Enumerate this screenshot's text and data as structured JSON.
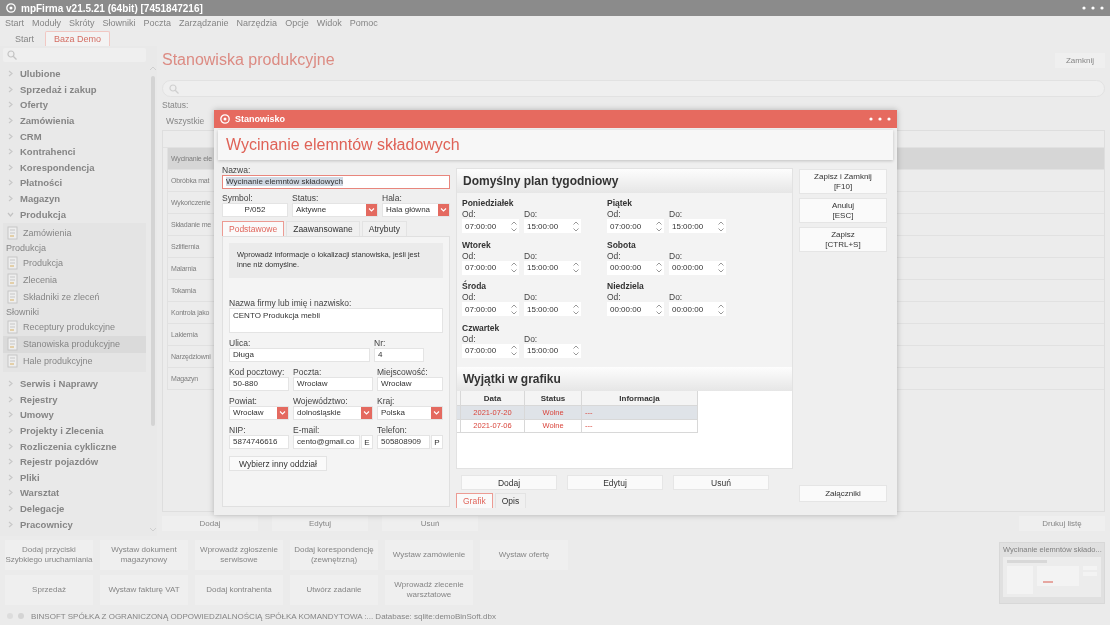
{
  "window": {
    "title": "mpFirma v21.5.21 (64bit) [7451847216]"
  },
  "menu": [
    "Start",
    "Moduły",
    "Skróty",
    "Słowniki",
    "Poczta",
    "Zarządzanie",
    "Narzędzia",
    "Opcje",
    "Widok",
    "Pomoc"
  ],
  "tabs": [
    {
      "label": "Start",
      "selected": false
    },
    {
      "label": "Baza Demo",
      "selected": true
    }
  ],
  "sidebar": {
    "items": [
      {
        "label": "Ulubione",
        "expanded": false
      },
      {
        "label": "Sprzedaż i zakup",
        "expanded": false
      },
      {
        "label": "Oferty",
        "expanded": false
      },
      {
        "label": "Zamówienia",
        "expanded": false
      },
      {
        "label": "CRM",
        "expanded": false
      },
      {
        "label": "Kontrahenci",
        "expanded": false
      },
      {
        "label": "Korespondencja",
        "expanded": false
      },
      {
        "label": "Płatności",
        "expanded": false
      },
      {
        "label": "Magazyn",
        "expanded": false
      },
      {
        "label": "Produkcja",
        "expanded": true,
        "children": [
          {
            "kind": "link",
            "label": "Zamówienia",
            "selected": false
          },
          {
            "kind": "section",
            "label": "Produkcja"
          },
          {
            "kind": "link",
            "label": "Produkcja",
            "selected": false
          },
          {
            "kind": "link",
            "label": "Zlecenia",
            "selected": false
          },
          {
            "kind": "link",
            "label": "Składniki ze zleceń",
            "selected": false
          },
          {
            "kind": "section",
            "label": "Słowniki"
          },
          {
            "kind": "link",
            "label": "Receptury produkcyjne",
            "selected": false
          },
          {
            "kind": "link",
            "label": "Stanowiska produkcyjne",
            "selected": true
          },
          {
            "kind": "link",
            "label": "Hale produkcyjne",
            "selected": false
          }
        ]
      },
      {
        "label": "Serwis i Naprawy",
        "expanded": false
      },
      {
        "label": "Rejestry",
        "expanded": false
      },
      {
        "label": "Umowy",
        "expanded": false
      },
      {
        "label": "Projekty i Zlecenia",
        "expanded": false
      },
      {
        "label": "Rozliczenia cykliczne",
        "expanded": false
      },
      {
        "label": "Rejestr pojazdów",
        "expanded": false
      },
      {
        "label": "Pliki",
        "expanded": false
      },
      {
        "label": "Warsztat",
        "expanded": false
      },
      {
        "label": "Delegacje",
        "expanded": false
      },
      {
        "label": "Pracownicy",
        "expanded": false
      }
    ]
  },
  "list_view": {
    "title": "Stanowiska produkcyjne",
    "close_button": "Zamknij",
    "status_label": "Status:",
    "status_value": "Wszystkie",
    "rows": [
      {
        "name": "Wycinanie ele",
        "selected": true
      },
      {
        "name": "Obróbka mat",
        "selected": false
      },
      {
        "name": "Wykończenie",
        "selected": false
      },
      {
        "name": "Składanie me",
        "selected": false
      },
      {
        "name": "Szlifiernia",
        "selected": false
      },
      {
        "name": "Malarnia",
        "selected": false
      },
      {
        "name": "Tokarnia",
        "selected": false
      },
      {
        "name": "Kontrola jako",
        "selected": false
      },
      {
        "name": "Lakiernia",
        "selected": false
      },
      {
        "name": "Narzędziowni",
        "selected": false
      },
      {
        "name": "Magazyn",
        "selected": false
      }
    ],
    "buttons": [
      "Dodaj",
      "Edytuj",
      "Usuń"
    ],
    "print_button": "Drukuj listę"
  },
  "quick_actions": [
    {
      "lines": [
        "Dodaj przyciski",
        "Szybkiego uruchamiania"
      ]
    },
    {
      "lines": [
        "Wystaw dokument",
        "magazynowy"
      ]
    },
    {
      "lines": [
        "Wprowadź zgłoszenie",
        "serwisowe"
      ]
    },
    {
      "lines": [
        "Dodaj korespondencję",
        "(zewnętrzną)"
      ]
    },
    {
      "lines": [
        "Wystaw zamówienie"
      ]
    },
    {
      "lines": [
        "Wystaw ofertę"
      ]
    },
    {
      "lines": [
        "Sprzedaż"
      ]
    },
    {
      "lines": [
        "Wystaw fakturę VAT"
      ]
    },
    {
      "lines": [
        "Dodaj kontrahenta"
      ]
    },
    {
      "lines": [
        "Utwórz zadanie"
      ]
    },
    {
      "lines": [
        "Wprowadź zlecenie",
        "warsztatowe"
      ]
    }
  ],
  "preview": {
    "title": "Wycinanie elemntów składo..."
  },
  "status_bar": {
    "text": "BINSOFT SPÓŁKA Z OGRANICZONĄ ODPOWIEDZIALNOŚCIĄ SPÓŁKA KOMANDYTOWA :... Database: sqlite:demoBinSoft.dbx"
  },
  "dialog": {
    "title": "Stanowisko",
    "heading": "Wycinanie elemntów składowych",
    "name": {
      "label": "Nazwa:",
      "value": "Wycinanie elemntów składowych"
    },
    "top_fields": [
      {
        "kind": "text",
        "label": "Symbol:",
        "value": "P/052"
      },
      {
        "kind": "dropdown",
        "label": "Status:",
        "value": "Aktywne"
      },
      {
        "kind": "dropdown",
        "label": "Hala:",
        "value": "Hala główna"
      }
    ],
    "tabs": [
      {
        "label": "Podstawowe",
        "selected": true
      },
      {
        "label": "Zaawansowane",
        "selected": false
      },
      {
        "label": "Atrybuty",
        "selected": false
      }
    ],
    "info": "Wprowadź informacje o lokalizacji stanowiska, jeśli jest inne niż domyślne.",
    "address_rows": [
      [
        {
          "kind": "textarea",
          "label": "Nazwa firmy lub imię i nazwisko:",
          "value": "CENTO Produkcja mebli"
        }
      ],
      [
        {
          "kind": "text",
          "label": "Ulica:",
          "value": "Długa"
        },
        {
          "kind": "text",
          "label": "Nr:",
          "value": "4"
        }
      ],
      [
        {
          "kind": "text",
          "label": "Kod pocztowy:",
          "value": "50-880"
        },
        {
          "kind": "text",
          "label": "Poczta:",
          "value": "Wrocław"
        },
        {
          "kind": "text",
          "label": "Miejscowość:",
          "value": "Wrocław"
        }
      ],
      [
        {
          "kind": "dropdown",
          "label": "Powiat:",
          "value": "Wrocław"
        },
        {
          "kind": "dropdown",
          "label": "Województwo:",
          "value": "dolnośląskie"
        },
        {
          "kind": "dropdown",
          "label": "Kraj:",
          "value": "Polska"
        }
      ],
      [
        {
          "kind": "text",
          "label": "NIP:",
          "value": "5874746616"
        },
        {
          "kind": "action",
          "label": "E-mail:",
          "value": "cento@gmail.co",
          "button": "E"
        },
        {
          "kind": "action",
          "label": "Telefon:",
          "value": "505808909",
          "button": "P"
        }
      ]
    ],
    "branch_button": "Wybierz inny oddział",
    "schedule": {
      "title": "Domyślny plan tygodniowy",
      "columns": [
        [
          {
            "day": "Poniedziałek",
            "from_label": "Od:",
            "from": "07:00:00",
            "to_label": "Do:",
            "to": "15:00:00"
          },
          {
            "day": "Wtorek",
            "from_label": "Od:",
            "from": "07:00:00",
            "to_label": "Do:",
            "to": "15:00:00"
          },
          {
            "day": "Środa",
            "from_label": "Od:",
            "from": "07:00:00",
            "to_label": "Do:",
            "to": "15:00:00"
          },
          {
            "day": "Czwartek",
            "from_label": "Od:",
            "from": "07:00:00",
            "to_label": "Do:",
            "to": "15:00:00"
          }
        ],
        [
          {
            "day": "Piątek",
            "from_label": "Od:",
            "from": "07:00:00",
            "to_label": "Do:",
            "to": "15:00:00"
          },
          {
            "day": "Sobota",
            "from_label": "Od:",
            "from": "00:00:00",
            "to_label": "Do:",
            "to": "00:00:00"
          },
          {
            "day": "Niedziela",
            "from_label": "Od:",
            "from": "00:00:00",
            "to_label": "Do:",
            "to": "00:00:00"
          }
        ]
      ]
    },
    "exceptions": {
      "title": "Wyjątki w grafiku",
      "columns": [
        "Data",
        "Status",
        "Informacja"
      ],
      "rows": [
        {
          "cells": [
            "2021-07-20",
            "Wolne",
            "---"
          ],
          "selected": true
        },
        {
          "cells": [
            "2021-07-06",
            "Wolne",
            "---"
          ],
          "selected": false
        }
      ],
      "buttons": [
        "Dodaj",
        "Edytuj",
        "Usuń"
      ]
    },
    "bottom_tabs": [
      {
        "label": "Grafik",
        "selected": true
      },
      {
        "label": "Opis",
        "selected": false
      }
    ],
    "actions": [
      {
        "label": "Zapisz i Zamknij",
        "shortcut": "[F10]"
      },
      {
        "label": "Anuluj",
        "shortcut": "[ESC]"
      },
      {
        "label": "Zapisz",
        "shortcut": "[CTRL+S]"
      }
    ],
    "attachments_button": "Załączniki"
  }
}
